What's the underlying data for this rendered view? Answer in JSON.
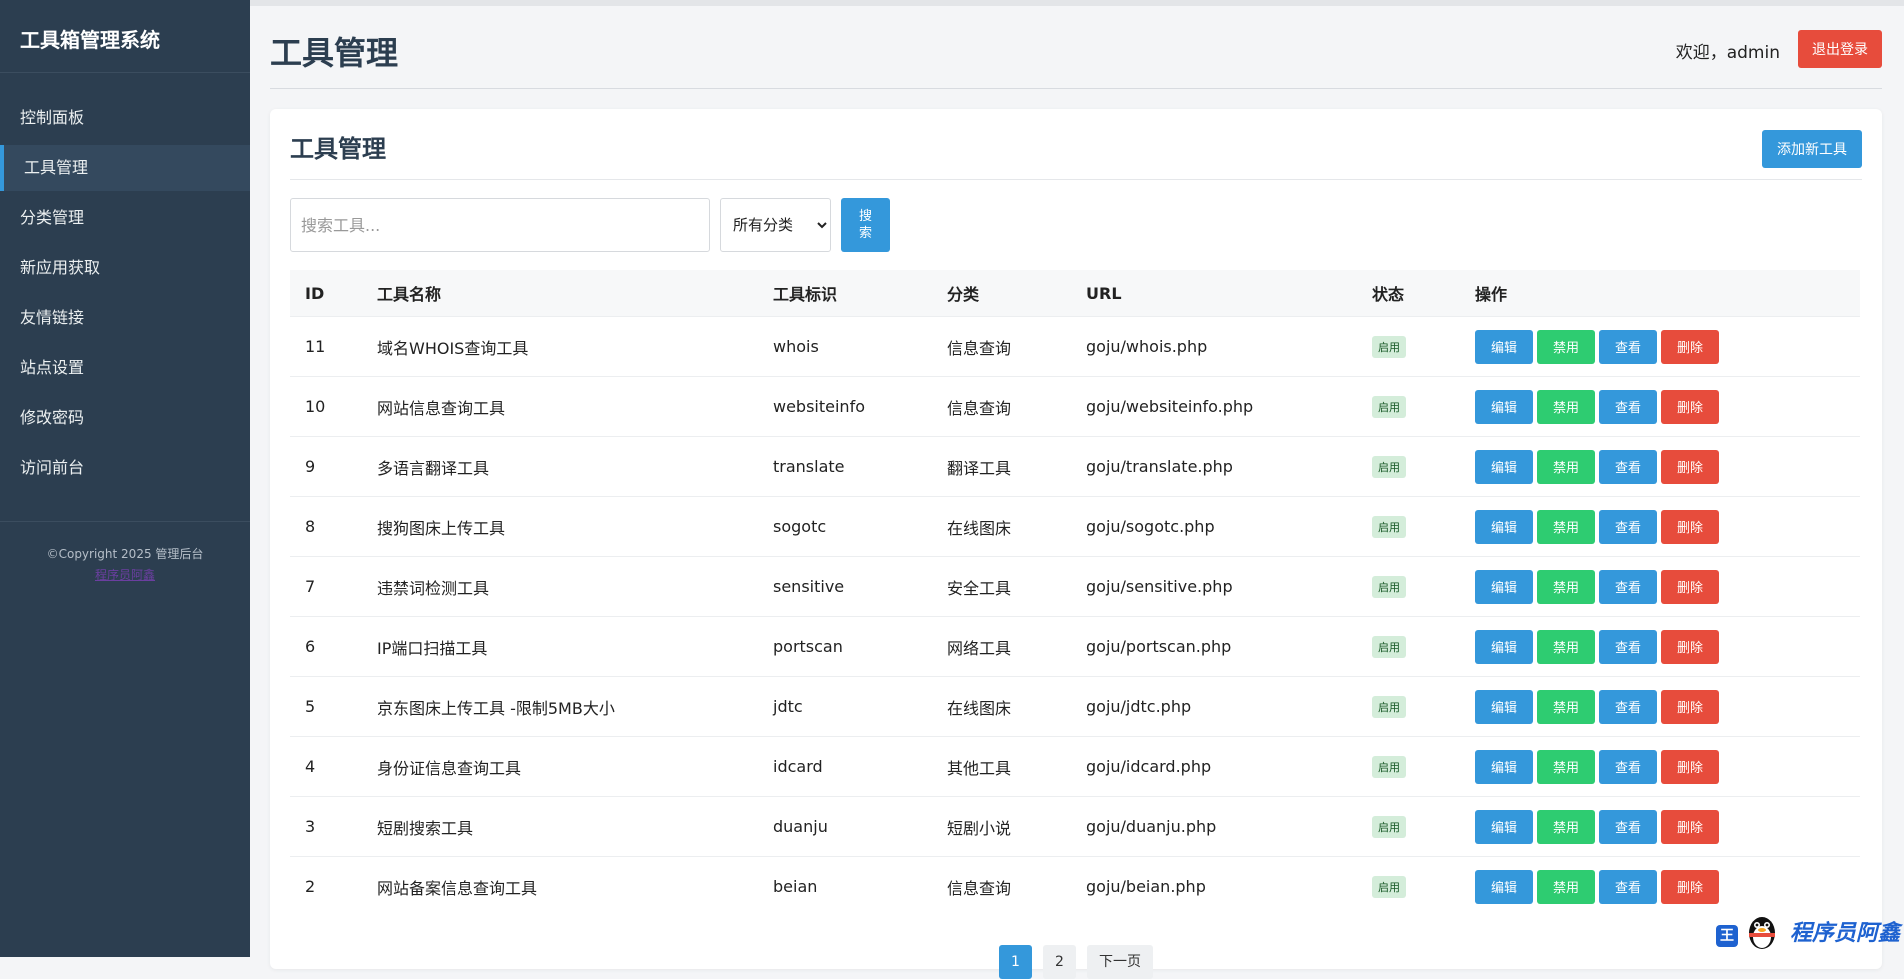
{
  "sidebar": {
    "brand": "工具箱管理系统",
    "items": [
      {
        "label": "控制面板",
        "active": false
      },
      {
        "label": "工具管理",
        "active": true
      },
      {
        "label": "分类管理",
        "active": false
      },
      {
        "label": "新应用获取",
        "active": false
      },
      {
        "label": "友情链接",
        "active": false
      },
      {
        "label": "站点设置",
        "active": false
      },
      {
        "label": "修改密码",
        "active": false
      },
      {
        "label": "访问前台",
        "active": false
      }
    ],
    "copyright": "©Copyright 2025 管理后台",
    "copyright_link": "程序员阿鑫"
  },
  "header": {
    "title": "工具管理",
    "welcome": "欢迎，admin",
    "logout_label": "退出登录"
  },
  "card": {
    "title": "工具管理",
    "add_label": "添加新工具"
  },
  "search": {
    "placeholder": "搜索工具...",
    "category_selected": "所有分类",
    "button_label": "搜索"
  },
  "table": {
    "headers": {
      "id": "ID",
      "name": "工具名称",
      "ident": "工具标识",
      "category": "分类",
      "url": "URL",
      "status": "状态",
      "actions": "操作"
    },
    "action_labels": {
      "edit": "编辑",
      "disable": "禁用",
      "view": "查看",
      "delete": "删除"
    },
    "rows": [
      {
        "id": "11",
        "name": "域名WHOIS查询工具",
        "ident": "whois",
        "category": "信息查询",
        "url": "goju/whois.php",
        "status": "启用"
      },
      {
        "id": "10",
        "name": "网站信息查询工具",
        "ident": "websiteinfo",
        "category": "信息查询",
        "url": "goju/websiteinfo.php",
        "status": "启用"
      },
      {
        "id": "9",
        "name": "多语言翻译工具",
        "ident": "translate",
        "category": "翻译工具",
        "url": "goju/translate.php",
        "status": "启用"
      },
      {
        "id": "8",
        "name": "搜狗图床上传工具",
        "ident": "sogotc",
        "category": "在线图床",
        "url": "goju/sogotc.php",
        "status": "启用"
      },
      {
        "id": "7",
        "name": "违禁词检测工具",
        "ident": "sensitive",
        "category": "安全工具",
        "url": "goju/sensitive.php",
        "status": "启用"
      },
      {
        "id": "6",
        "name": "IP端口扫描工具",
        "ident": "portscan",
        "category": "网络工具",
        "url": "goju/portscan.php",
        "status": "启用"
      },
      {
        "id": "5",
        "name": "京东图床上传工具 -限制5MB大小",
        "ident": "jdtc",
        "category": "在线图床",
        "url": "goju/jdtc.php",
        "status": "启用"
      },
      {
        "id": "4",
        "name": "身份证信息查询工具",
        "ident": "idcard",
        "category": "其他工具",
        "url": "goju/idcard.php",
        "status": "启用"
      },
      {
        "id": "3",
        "name": "短剧搜索工具",
        "ident": "duanju",
        "category": "短剧小说",
        "url": "goju/duanju.php",
        "status": "启用"
      },
      {
        "id": "2",
        "name": "网站备案信息查询工具",
        "ident": "beian",
        "category": "信息查询",
        "url": "goju/beian.php",
        "status": "启用"
      }
    ]
  },
  "pagination": {
    "pages": [
      "1",
      "2"
    ],
    "current": "1",
    "next_label": "下一页"
  },
  "watermark": {
    "badge": "王",
    "text": "程序员阿鑫"
  },
  "colors": {
    "sidebar_bg": "#2c3e50",
    "primary": "#3498db",
    "success": "#2ecc71",
    "danger": "#e74c3c"
  }
}
